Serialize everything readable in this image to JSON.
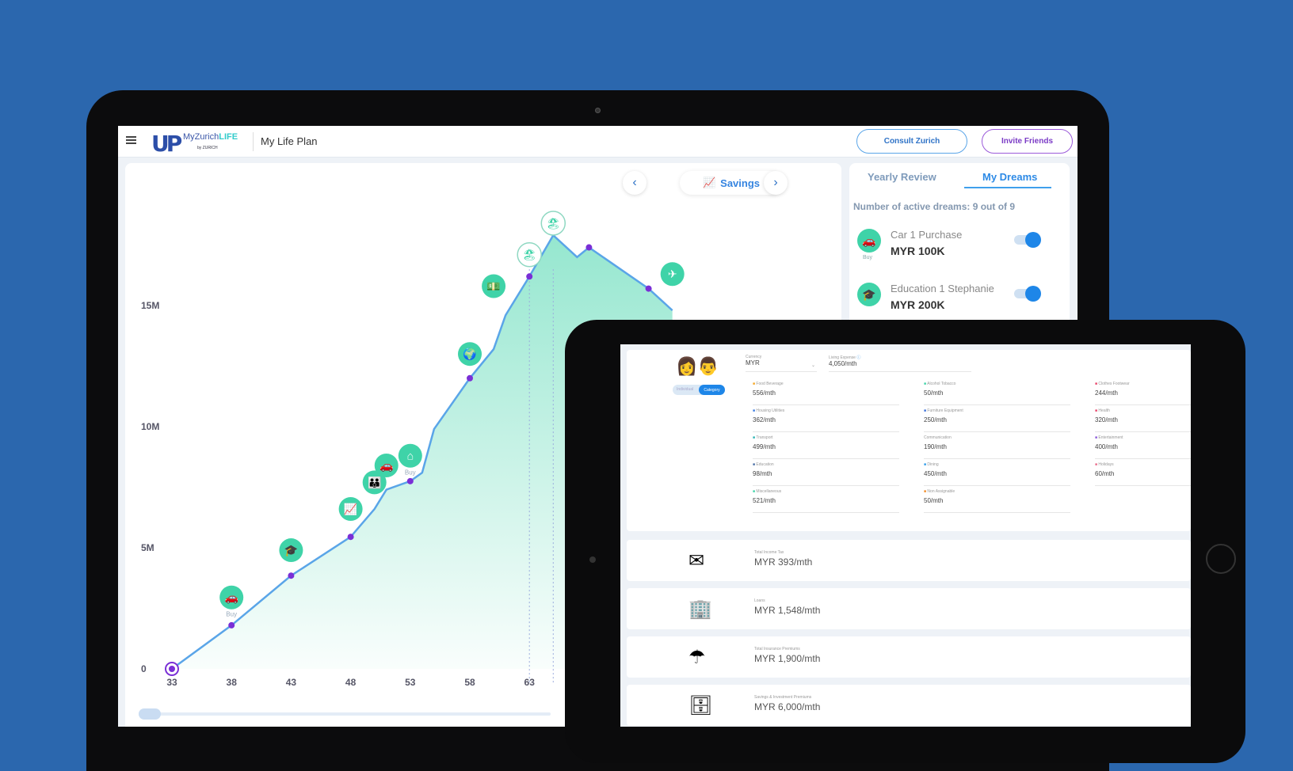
{
  "header": {
    "logo_brand": "MyZurich",
    "logo_life": "LIFE",
    "logo_by": "by ZURICH",
    "title": "My Life Plan",
    "consult_label": "Consult Zurich",
    "invite_label": "Invite Friends"
  },
  "chart_nav": {
    "label": "Savings",
    "prev": "‹",
    "next": "›"
  },
  "tabs": [
    {
      "label": "Yearly Review",
      "active": false
    },
    {
      "label": "My Dreams",
      "active": true
    }
  ],
  "dreams": {
    "count_text": "Number of active dreams: 9 out of 9",
    "items": [
      {
        "name": "Car 1 Purchase",
        "amount": "MYR 100K",
        "tag": "Buy",
        "icon": "car-icon",
        "enabled": true
      },
      {
        "name": "Education 1 Stephanie",
        "amount": "MYR 200K",
        "tag": "",
        "icon": "graduation-cap-icon",
        "enabled": true
      }
    ]
  },
  "colors": {
    "background": "#2b67ae",
    "accent": "#3584e0",
    "dream_icon": "#3fd3a8",
    "line": "#5aa5e8",
    "point": "#7a2fd6"
  },
  "chart_data": {
    "type": "area",
    "xlabel": "",
    "ylabel": "",
    "x_ticks": [
      33,
      38,
      43,
      48,
      53,
      58,
      63
    ],
    "y_ticks": [
      {
        "v": 0,
        "label": "0"
      },
      {
        "v": 5,
        "label": "5M"
      },
      {
        "v": 10,
        "label": "10M"
      },
      {
        "v": 15,
        "label": "15M"
      }
    ],
    "y_unit": "M",
    "xlim": [
      33,
      75
    ],
    "ylim": [
      0,
      19
    ],
    "series": [
      {
        "x": [
          33,
          38,
          43,
          48,
          50,
          51,
          53,
          54,
          55,
          58,
          60,
          61,
          63,
          65,
          67,
          68,
          73,
          75
        ],
        "y": [
          0,
          1.8,
          3.85,
          5.45,
          6.6,
          7.4,
          7.75,
          8.1,
          9.9,
          12,
          13.2,
          14.6,
          16.2,
          17.9,
          17.0,
          17.4,
          15.7,
          14.8
        ]
      }
    ],
    "points": [
      {
        "x": 33,
        "y": 0
      },
      {
        "x": 38,
        "y": 1.8
      },
      {
        "x": 43,
        "y": 3.85
      },
      {
        "x": 48,
        "y": 5.45
      },
      {
        "x": 53,
        "y": 7.75
      },
      {
        "x": 58,
        "y": 12
      },
      {
        "x": 63,
        "y": 16.2
      },
      {
        "x": 68,
        "y": 17.4
      },
      {
        "x": 73,
        "y": 15.7
      }
    ],
    "dream_markers": [
      {
        "x": 38,
        "y": 2.95,
        "icon": "car",
        "glyph": "🚗",
        "label": "Buy"
      },
      {
        "x": 43,
        "y": 4.9,
        "icon": "graduation-cap",
        "glyph": "🎓",
        "label": ""
      },
      {
        "x": 48,
        "y": 6.6,
        "icon": "investment-chart",
        "glyph": "📈",
        "label": ""
      },
      {
        "x": 50,
        "y": 7.7,
        "icon": "family",
        "glyph": "👪",
        "label": ""
      },
      {
        "x": 51,
        "y": 8.4,
        "icon": "car",
        "glyph": "🚗",
        "label": ""
      },
      {
        "x": 53,
        "y": 8.8,
        "icon": "home",
        "glyph": "⌂",
        "label": "Buy"
      },
      {
        "x": 58,
        "y": 13,
        "icon": "globe",
        "glyph": "🌍",
        "label": ""
      },
      {
        "x": 60,
        "y": 15.8,
        "icon": "money",
        "glyph": "💵",
        "label": ""
      },
      {
        "x": 63,
        "y": 17.1,
        "icon": "retirement-beach",
        "glyph": "🏖",
        "label": "",
        "outline": true
      },
      {
        "x": 65,
        "y": 18.4,
        "icon": "retirement-beach",
        "glyph": "🏖",
        "label": "",
        "outline": true
      },
      {
        "x": 75,
        "y": 16.3,
        "icon": "airplane",
        "glyph": "✈",
        "label": ""
      }
    ]
  },
  "expenses": {
    "currency_label": "Currency",
    "currency": "MYR",
    "living_label": "Living Expense",
    "living": "4,050/mth",
    "mode_individual": "Individual",
    "mode_category": "Category",
    "items": [
      {
        "label": "Food Beverage",
        "value": "556/mth",
        "color": "#f5a623"
      },
      {
        "label": "Alcohol Tobacco",
        "value": "50/mth",
        "color": "#3fd3a8"
      },
      {
        "label": "Clothes Footwear",
        "value": "244/mth",
        "color": "#e8456b"
      },
      {
        "label": "Housing Utilities",
        "value": "362/mth",
        "color": "#3b7be0"
      },
      {
        "label": "Furniture Equipment",
        "value": "250/mth",
        "color": "#3b6fd8"
      },
      {
        "label": "Health",
        "value": "320/mth",
        "color": "#e8456b"
      },
      {
        "label": "Transport",
        "value": "499/mth",
        "color": "#2bb3b3"
      },
      {
        "label": "Communication",
        "value": "190/mth",
        "color": ""
      },
      {
        "label": "Entertainment",
        "value": "400/mth",
        "color": "#8a5ad9"
      },
      {
        "label": "Education",
        "value": "98/mth",
        "color": "#4a6fa5"
      },
      {
        "label": "Dining",
        "value": "450/mth",
        "color": "#2d9be8"
      },
      {
        "label": "Holidays",
        "value": "60/mth",
        "color": "#e86b8a"
      },
      {
        "label": "Miscellaneous",
        "value": "521/mth",
        "color": "#3fd3a8"
      },
      {
        "label": "Non Assignable",
        "value": "50/mth",
        "color": "#f08a24"
      }
    ]
  },
  "summary": [
    {
      "label": "Total Income Tax",
      "value": "MYR 393/mth",
      "icon": "tax-envelope-icon",
      "glyph": "✉"
    },
    {
      "label": "Loans",
      "value": "MYR 1,548/mth",
      "icon": "building-car-icon",
      "glyph": "🏢"
    },
    {
      "label": "Total Insurance Premiums",
      "value": "MYR 1,900/mth",
      "icon": "umbrella-icon",
      "glyph": "☂"
    },
    {
      "label": "Savings & Investment Premiums",
      "value": "MYR 6,000/mth",
      "icon": "safe-icon",
      "glyph": "🗄"
    }
  ]
}
